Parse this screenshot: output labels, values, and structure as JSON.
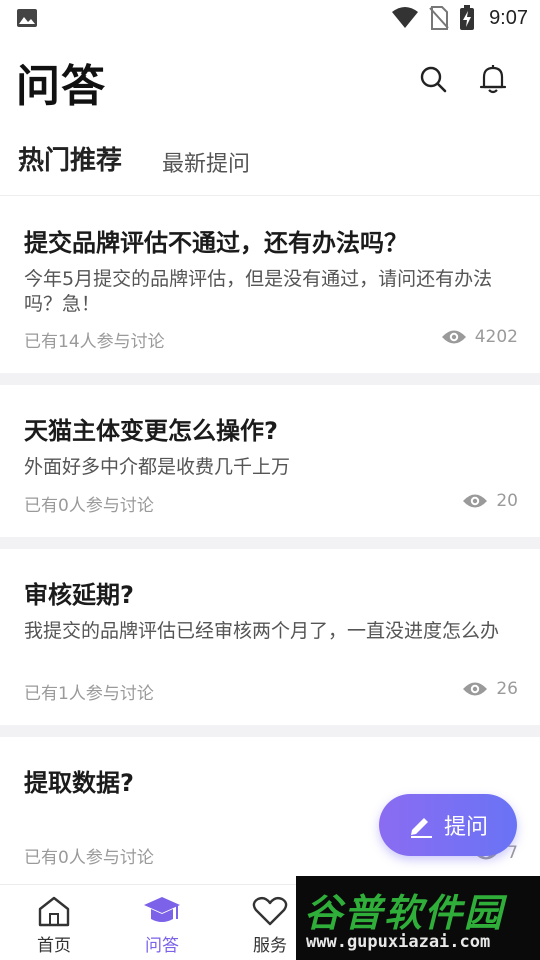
{
  "status_bar": {
    "time": "9:07",
    "icons": [
      "gallery-icon",
      "wifi-icon",
      "no-sim-icon",
      "battery-charging-icon"
    ]
  },
  "header": {
    "title": "问答",
    "icons": [
      "search-icon",
      "bell-icon"
    ]
  },
  "tabs": [
    {
      "label": "热门推荐",
      "active": true
    },
    {
      "label": "最新提问",
      "active": false
    }
  ],
  "questions": [
    {
      "title": "提交品牌评估不通过，还有办法吗？",
      "description": "今年5月提交的品牌评估，但是没有通过，请问还有办法吗？急！",
      "participants": "已有14人参与讨论",
      "views": "4202"
    },
    {
      "title": "天猫主体变更怎么操作?",
      "description": "外面好多中介都是收费几千上万",
      "participants": "已有0人参与讨论",
      "views": "20"
    },
    {
      "title": "审核延期?",
      "description": "我提交的品牌评估已经审核两个月了，一直没进度怎么办",
      "participants": "已有1人参与讨论",
      "views": "26"
    },
    {
      "title": "提取数据?",
      "description": "",
      "participants": "已有0人参与讨论",
      "views": "7"
    }
  ],
  "fab": {
    "label": "提问",
    "icon": "pencil-icon"
  },
  "bottom_nav": [
    {
      "label": "首页",
      "icon": "home-icon",
      "active": false
    },
    {
      "label": "问答",
      "icon": "graduation-cap-icon",
      "active": true
    },
    {
      "label": "服务",
      "icon": "heart-icon",
      "active": false
    }
  ],
  "watermark": {
    "cn": "谷普软件园",
    "en": "www.gupuxiazai.com"
  },
  "colors": {
    "accent": "#7b62e8",
    "tab_highlight": "#b9a8ee",
    "fab_start": "#8a6cf2",
    "fab_end": "#6a73f5"
  }
}
